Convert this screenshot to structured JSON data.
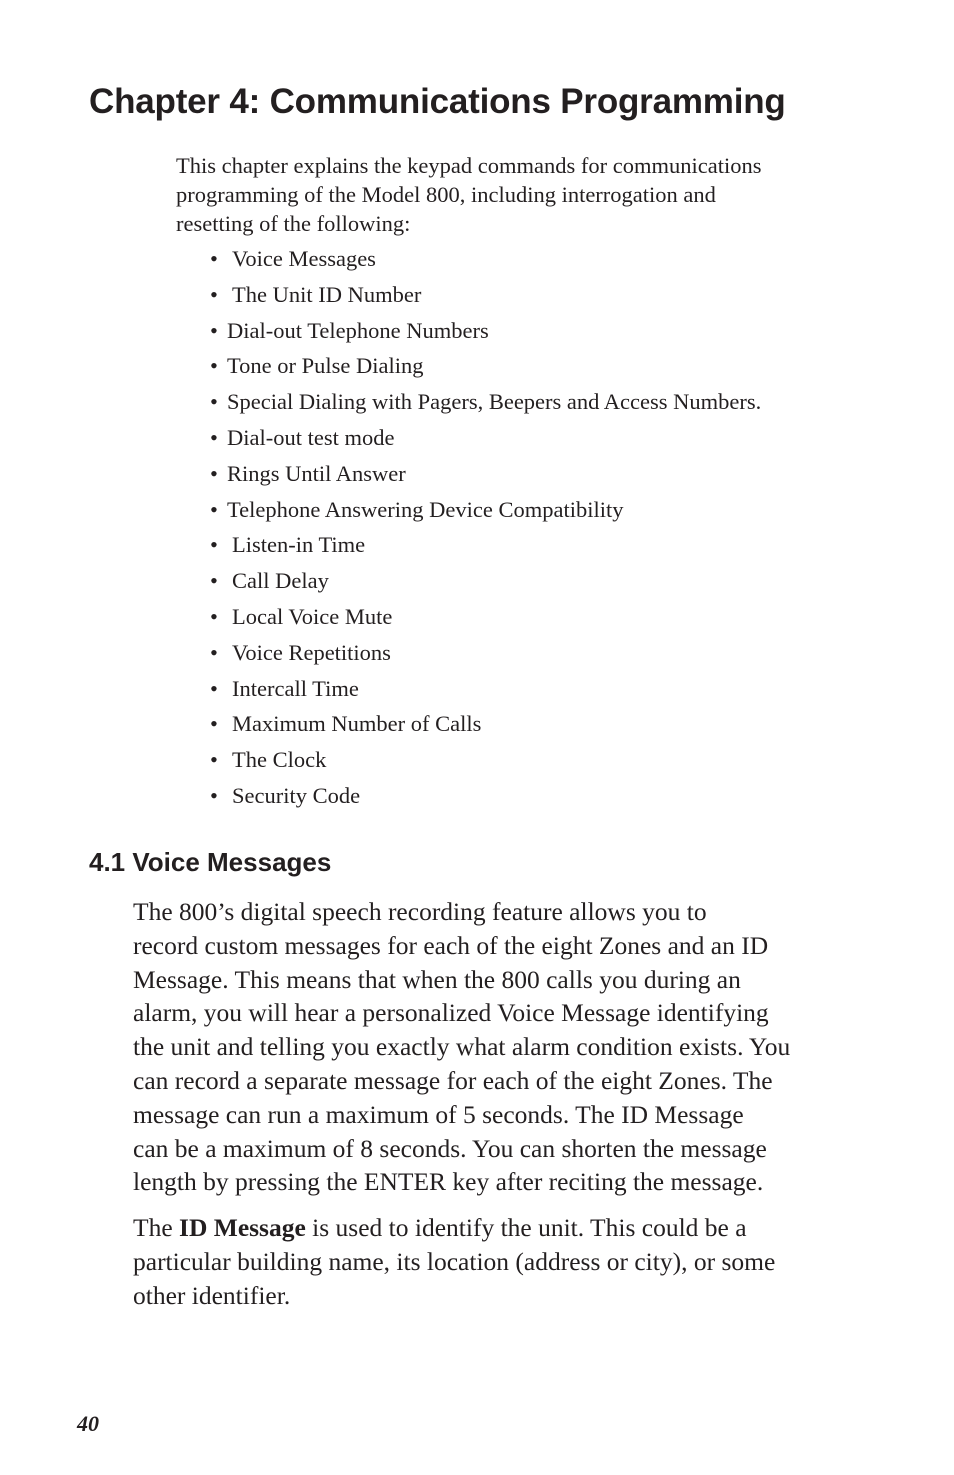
{
  "chapter": {
    "title": "Chapter 4: Communications Programming",
    "intro_lines": [
      "This chapter explains the keypad commands for  communications",
      "programming of the Model 800, including interrogation and",
      "resetting of the following:"
    ],
    "bullet_glyph": "•",
    "bullets": [
      {
        "label": "Voice Messages",
        "wide": true
      },
      {
        "label": "The Unit ID Number",
        "wide": true
      },
      {
        "label": "Dial-out Telephone Numbers",
        "wide": false
      },
      {
        "label": "Tone or Pulse Dialing",
        "wide": false
      },
      {
        "label": "Special Dialing with Pagers, Beepers and Access Numbers.",
        "wide": false
      },
      {
        "label": "Dial-out test mode",
        "wide": false
      },
      {
        "label": "Rings Until Answer",
        "wide": false
      },
      {
        "label": "Telephone Answering Device Compatibility",
        "wide": false
      },
      {
        "label": "Listen-in Time",
        "wide": true
      },
      {
        "label": "Call Delay",
        "wide": true
      },
      {
        "label": "Local Voice Mute",
        "wide": true
      },
      {
        "label": "Voice Repetitions",
        "wide": true
      },
      {
        "label": "Intercall Time",
        "wide": true
      },
      {
        "label": "Maximum Number of Calls",
        "wide": true
      },
      {
        "label": "The Clock",
        "wide": true
      },
      {
        "label": "Security Code",
        "wide": true
      }
    ]
  },
  "section": {
    "title": "4.1 Voice Messages",
    "paragraph1_lines": [
      "The 800’s digital speech recording feature allows you to",
      "record custom messages for each of the eight Zones and an ID",
      "Message. This means that when the 800 calls you during an",
      "alarm, you will hear a personalized Voice Message identifying",
      "the unit and telling you exactly what alarm condition exists. You",
      "can record a separate message for each of the eight Zones. The",
      "message can run a maximum of 5 seconds. The ID Message",
      "can be a maximum of 8 seconds. You can shorten the message",
      "length by pressing the ENTER key after reciting the message."
    ],
    "paragraph2": {
      "line1_prefix": "The ",
      "line1_bold": "ID Message",
      "line1_suffix": " is used to identify the unit.  This could be a",
      "line2": "particular building name, its location (address or city), or some",
      "line3": "other identifier."
    }
  },
  "footer": {
    "page_number": "40"
  }
}
